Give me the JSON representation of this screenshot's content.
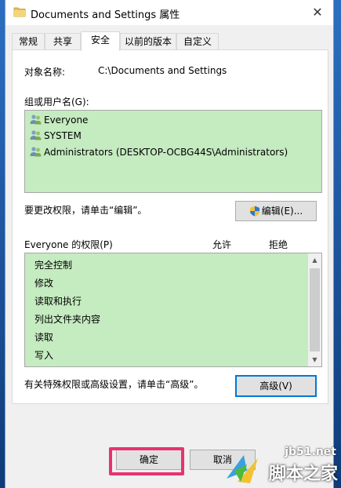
{
  "window": {
    "title": "Documents and Settings 属性",
    "close_glyph": "✕"
  },
  "tabs": [
    {
      "label": "常规"
    },
    {
      "label": "共享"
    },
    {
      "label": "安全"
    },
    {
      "label": "以前的版本"
    },
    {
      "label": "自定义"
    }
  ],
  "object": {
    "label": "对象名称:",
    "value": "C:\\Documents and Settings"
  },
  "groups": {
    "label": "组或用户名(G):",
    "items": [
      {
        "name": "Everyone",
        "icon": "users-icon"
      },
      {
        "name": "SYSTEM",
        "icon": "users-icon"
      },
      {
        "name": "Administrators (DESKTOP-OCBG44S\\Administrators)",
        "icon": "users-icon"
      }
    ]
  },
  "change_hint": "要更改权限，请单击“编辑”。",
  "edit_button": "编辑(E)...",
  "permissions": {
    "label": "Everyone 的权限(P)",
    "allow_header": "允许",
    "deny_header": "拒绝",
    "items": [
      {
        "name": "完全控制"
      },
      {
        "name": "修改"
      },
      {
        "name": "读取和执行"
      },
      {
        "name": "列出文件夹内容"
      },
      {
        "name": "读取"
      },
      {
        "name": "写入"
      }
    ]
  },
  "advanced_hint": "有关特殊权限或高级设置，请单击“高级”。",
  "advanced_button": "高级(V)",
  "ok_button": "确定",
  "cancel_button": "取消",
  "watermark": {
    "site": "jb51.net",
    "name": "脚本之家"
  },
  "colors": {
    "list_background": "#c5ebc0",
    "highlight": "#e8336e",
    "focus_border": "#0078d7",
    "desktop": "#1b5fae"
  }
}
